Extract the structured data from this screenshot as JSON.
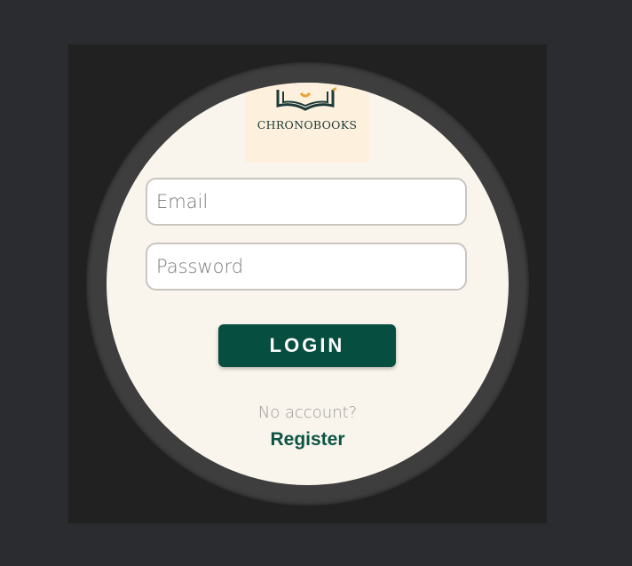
{
  "logo": {
    "text": "CHRONOBOOKS",
    "icon": "open-book-icon"
  },
  "email": {
    "placeholder": "Email",
    "value": ""
  },
  "password": {
    "placeholder": "Password",
    "value": ""
  },
  "login": {
    "label": "LOGIN"
  },
  "register": {
    "prompt": "No account?",
    "link_label": "Register"
  },
  "colors": {
    "background": "#2b2c2f",
    "screen": "#f9f4ec",
    "primary": "#064e3f",
    "logo_box": "#fdf0dc",
    "logo_accent": "#e6a53a"
  }
}
